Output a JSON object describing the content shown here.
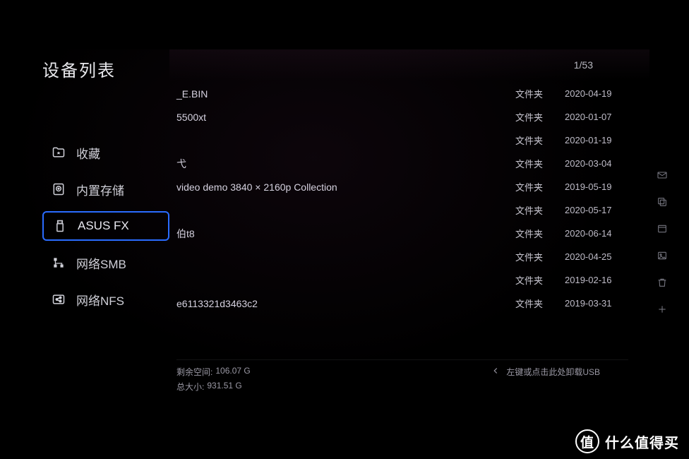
{
  "sidebar": {
    "title": "设备列表",
    "items": [
      {
        "label": "收藏",
        "icon": "folder-star-icon",
        "selected": false
      },
      {
        "label": "内置存储",
        "icon": "disk-icon",
        "selected": false
      },
      {
        "label": "ASUS FX",
        "icon": "usb-icon",
        "selected": true
      },
      {
        "label": "网络SMB",
        "icon": "network-icon",
        "selected": false
      },
      {
        "label": "网络NFS",
        "icon": "share-icon",
        "selected": false
      }
    ]
  },
  "pager": "1/53",
  "files": [
    {
      "name": "_E.BIN",
      "type": "文件夹",
      "date": "2020-04-19"
    },
    {
      "name": "5500xt",
      "type": "文件夹",
      "date": "2020-01-07"
    },
    {
      "name": "",
      "type": "文件夹",
      "date": "2020-01-19"
    },
    {
      "name": "弋",
      "type": "文件夹",
      "date": "2020-03-04"
    },
    {
      "name": "video demo 3840 × 2160p Collection",
      "type": "文件夹",
      "date": "2019-05-19"
    },
    {
      "name": "",
      "type": "文件夹",
      "date": "2020-05-17"
    },
    {
      "name": "伯t8",
      "type": "文件夹",
      "date": "2020-06-14"
    },
    {
      "name": "",
      "type": "文件夹",
      "date": "2020-04-25"
    },
    {
      "name": "",
      "type": "文件夹",
      "date": "2019-02-16"
    },
    {
      "name": "e6113321d3463c2",
      "type": "文件夹",
      "date": "2019-03-31"
    }
  ],
  "footer": {
    "free_label": "剩余空间:",
    "free_value": "106.07 G",
    "total_label": "总大小:",
    "total_value": "931.51 G",
    "eject_hint": "左键或点击此处卸载USB"
  },
  "right_icons": [
    "mail-icon",
    "copy-icon",
    "window-icon",
    "image-icon",
    "trash-icon",
    "plus-icon"
  ],
  "watermark": {
    "badge": "值",
    "text": "什么值得买"
  }
}
